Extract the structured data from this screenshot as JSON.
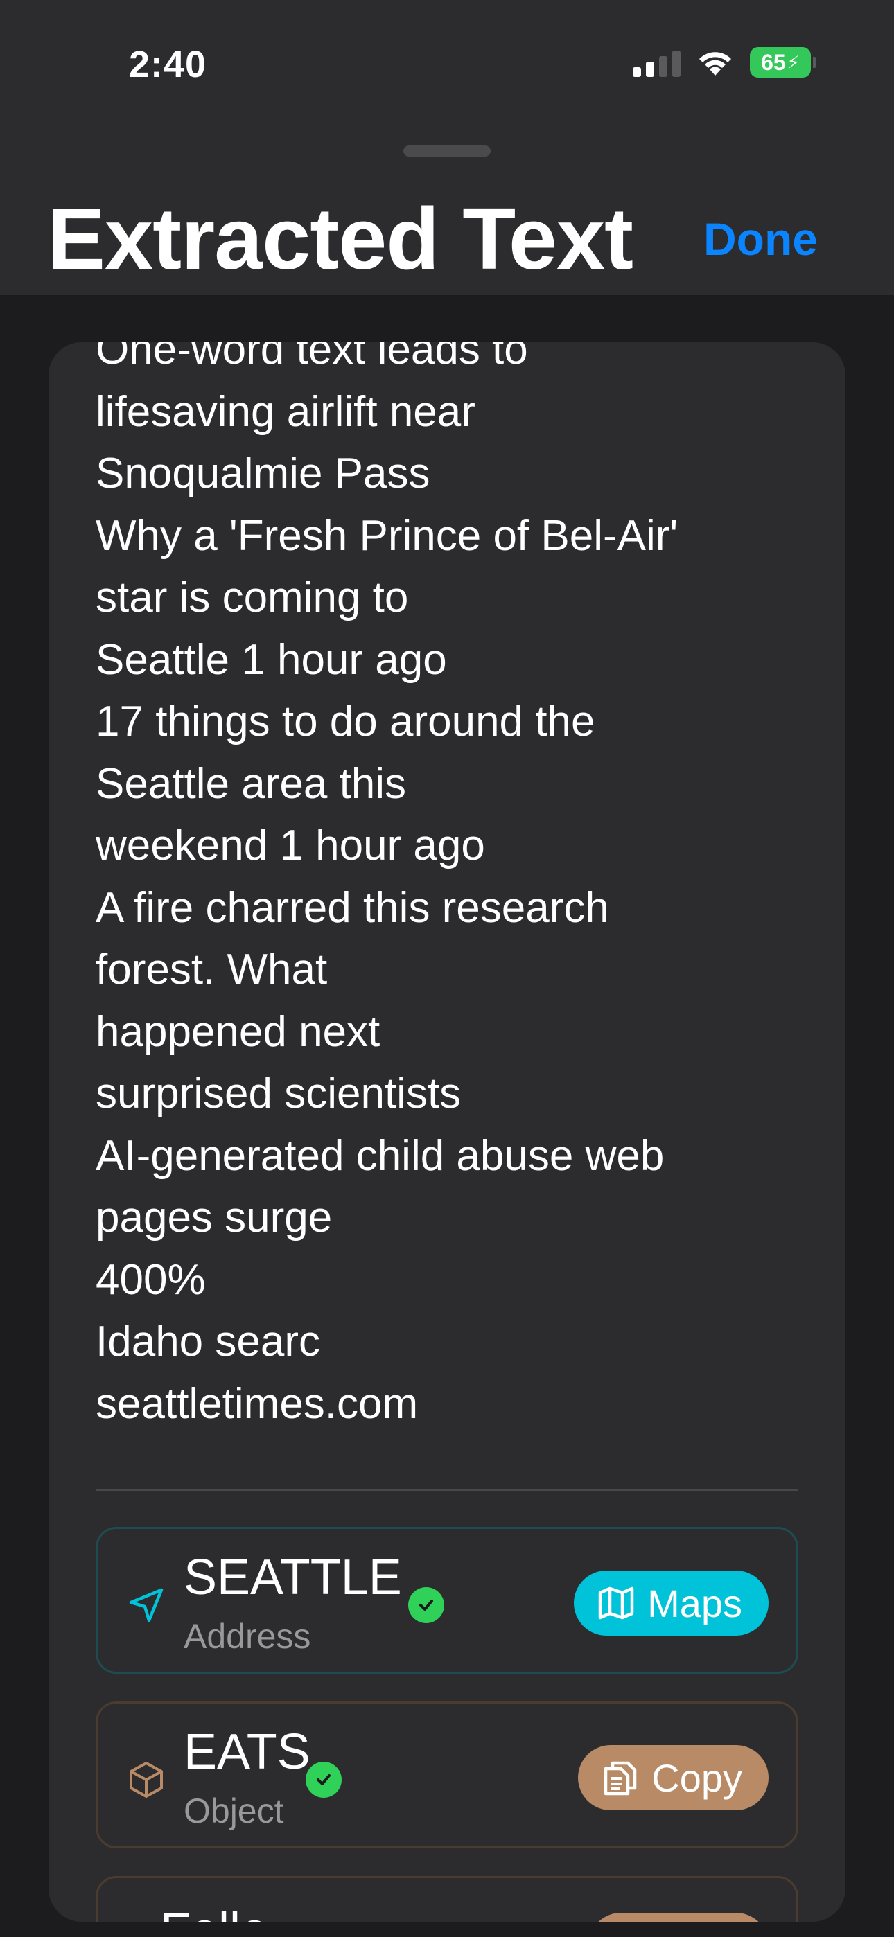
{
  "status_bar": {
    "time": "2:40",
    "battery": "65",
    "icons": [
      "cellular-signal-icon",
      "wifi-icon",
      "battery-charging-icon"
    ]
  },
  "sheet": {
    "title": "Extracted Text",
    "done_label": "Done"
  },
  "extracted_text": "One-word text leads to\nlifesaving airlift near\nSnoqualmie Pass\nWhy a 'Fresh Prince of Bel-Air'\nstar is coming to\nSeattle 1 hour ago\n17 things to do around the\nSeattle area this\nweekend 1 hour ago\nA fire charred this research\nforest. What\nhappened next\nsurprised scientists\nAI-generated child abuse web\npages surge\n400%\nIdaho searc\nseattletimes.com",
  "entities": [
    {
      "name": "SEATTLE",
      "type": "Address",
      "icon": "location-arrow-icon",
      "verified": true,
      "action": "Maps",
      "action_icon": "map-icon",
      "accent": "#00c2d8"
    },
    {
      "name": "EATS",
      "type": "Object",
      "icon": "cube-icon",
      "verified": true,
      "action": "Copy",
      "action_icon": "copy-icon",
      "accent": "#b88a66"
    },
    {
      "name": "Follo",
      "type": "",
      "icon": "",
      "verified": false,
      "action": "",
      "action_icon": "",
      "accent": "#b88a66"
    }
  ],
  "colors": {
    "background": "#1c1c1e",
    "surface": "#2c2c2e",
    "accent_blue": "#0a84ff",
    "verified_green": "#30d158"
  }
}
